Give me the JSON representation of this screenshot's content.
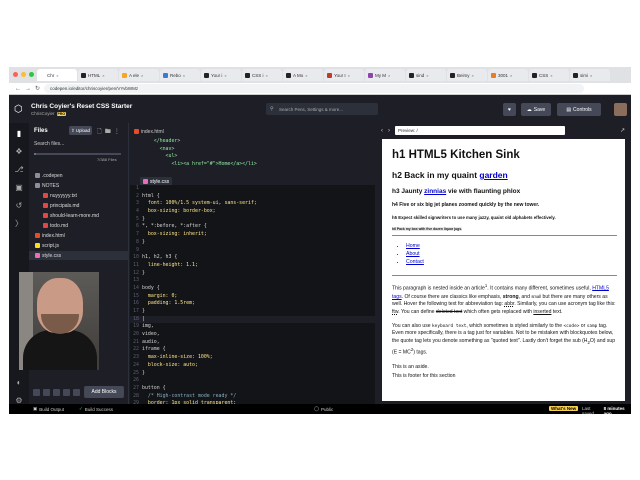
{
  "browser": {
    "tabs": [
      {
        "label": "Chr",
        "active": true,
        "fav": "#ffffff"
      },
      {
        "label": "HTML",
        "active": false,
        "fav": "#222"
      },
      {
        "label": "A ele",
        "active": false,
        "fav": "#f5a623"
      },
      {
        "label": "Rebo",
        "active": false,
        "fav": "#3a7bd5"
      },
      {
        "label": "Your i",
        "active": false,
        "fav": "#222"
      },
      {
        "label": "CSS i",
        "active": false,
        "fav": "#222"
      },
      {
        "label": "A Mo",
        "active": false,
        "fav": "#222"
      },
      {
        "label": "Your I",
        "active": false,
        "fav": "#c0392b"
      },
      {
        "label": "My M",
        "active": false,
        "fav": "#8e44ad"
      },
      {
        "label": "sind",
        "active": false,
        "fav": "#222"
      },
      {
        "label": "Beimy",
        "active": false,
        "fav": "#222"
      },
      {
        "label": "3001",
        "active": false,
        "fav": "#e67e22"
      },
      {
        "label": "CSS",
        "active": false,
        "fav": "#222"
      },
      {
        "label": "simi",
        "active": false,
        "fav": "#222"
      }
    ],
    "url": "codepen.io/editor/chriscoyier/pen/VYvbWMz"
  },
  "header": {
    "pen_title": "Chris Coyier's Reset CSS Starter",
    "author": "ChrisCoyier",
    "pro_badge": "PRO",
    "search_placeholder": "Search Pens, Settings & more...",
    "save_label": "Save",
    "controls_label": "Controls"
  },
  "files": {
    "title": "Files",
    "upload_label": "Upload",
    "search_label": "Search files...",
    "storage_text": "7/388 Files",
    "storage_fraction": 0.02,
    "items": [
      {
        "label": ".codepen",
        "color": "#8a8f9c",
        "indent": 0
      },
      {
        "label": "NOTES",
        "color": "#8a8f9c",
        "indent": 0
      },
      {
        "label": "nuyyyyyy.txt",
        "color": "#e04848",
        "indent": 1
      },
      {
        "label": "principals.md",
        "color": "#e04848",
        "indent": 1
      },
      {
        "label": "should-learn-more.md",
        "color": "#e04848",
        "indent": 1
      },
      {
        "label": "todo.md",
        "color": "#e04848",
        "indent": 1
      },
      {
        "label": "index.html",
        "color": "#e44d26",
        "indent": 0
      },
      {
        "label": "script.js",
        "color": "#f7df1e",
        "indent": 0
      },
      {
        "label": "style.css",
        "color": "#ec6cb9",
        "indent": 0,
        "selected": true
      }
    ],
    "add_blocks_label": "Add Blocks"
  },
  "editor": {
    "html_tab_label": "index.html",
    "css_tab_label": "style.css",
    "html_lines": [
      {
        "n": "",
        "code": "    </header>",
        "cls": "c-tag"
      },
      {
        "n": "",
        "code": "      <nav>",
        "cls": "c-tag"
      },
      {
        "n": "",
        "code": "        <ul>",
        "cls": "c-tag"
      },
      {
        "n": "",
        "code": "          <li><a href=\"#\">Home</a></li>",
        "cls": "c-tag"
      }
    ],
    "css_lines": [
      {
        "n": "1",
        "code": "",
        "cls": "cv"
      },
      {
        "n": "2",
        "code": "html {",
        "cls": "c-sel"
      },
      {
        "n": "3",
        "code": "  font: 100%/1.5 system-ui, sans-serif;",
        "cls": "c-val"
      },
      {
        "n": "4",
        "code": "  box-sizing: border-box;",
        "cls": "c-val"
      },
      {
        "n": "5",
        "code": "}",
        "cls": "c-sel"
      },
      {
        "n": "6",
        "code": "*, *:before, *:after {",
        "cls": "c-sel"
      },
      {
        "n": "7",
        "code": "  box-sizing: inherit;",
        "cls": "c-val"
      },
      {
        "n": "8",
        "code": "}",
        "cls": "c-sel"
      },
      {
        "n": "9",
        "code": "",
        "cls": "cv"
      },
      {
        "n": "10",
        "code": "h1, h2, h3 {",
        "cls": "c-sel"
      },
      {
        "n": "11",
        "code": "  line-height: 1.1;",
        "cls": "c-val"
      },
      {
        "n": "12",
        "code": "}",
        "cls": "c-sel"
      },
      {
        "n": "13",
        "code": "",
        "cls": "cv"
      },
      {
        "n": "14",
        "code": "body {",
        "cls": "c-sel"
      },
      {
        "n": "15",
        "code": "  margin: 0;",
        "cls": "c-val"
      },
      {
        "n": "16",
        "code": "  padding: 1.5rem;",
        "cls": "c-val"
      },
      {
        "n": "17",
        "code": "}",
        "cls": "c-sel"
      },
      {
        "n": "18",
        "code": "|",
        "cls": "cv",
        "cursor": true
      },
      {
        "n": "19",
        "code": "img,",
        "cls": "c-sel"
      },
      {
        "n": "20",
        "code": "video,",
        "cls": "c-sel"
      },
      {
        "n": "21",
        "code": "audio,",
        "cls": "c-sel"
      },
      {
        "n": "22",
        "code": "iframe {",
        "cls": "c-sel"
      },
      {
        "n": "23",
        "code": "  max-inline-size: 100%;",
        "cls": "c-val"
      },
      {
        "n": "24",
        "code": "  block-size: auto;",
        "cls": "c-val"
      },
      {
        "n": "25",
        "code": "}",
        "cls": "c-sel"
      },
      {
        "n": "26",
        "code": "",
        "cls": "cv"
      },
      {
        "n": "27",
        "code": "button {",
        "cls": "c-sel"
      },
      {
        "n": "28",
        "code": "  /* High-contrast mode ready */",
        "cls": "c-com"
      },
      {
        "n": "29",
        "code": "  border: 1px solid transparent;",
        "cls": "c-val"
      },
      {
        "n": "30",
        "code": "}",
        "cls": "c-sel"
      },
      {
        "n": "31",
        "code": "",
        "cls": "cv"
      },
      {
        "n": "32",
        "code": "input,",
        "cls": "c-sel"
      }
    ]
  },
  "preview": {
    "url_label": "Preview: /",
    "h1": "h1 HTML5 Kitchen Sink",
    "h2_prefix": "h2 Back in my quaint ",
    "h2_link": "garden",
    "h3_prefix": "h3 Jaunty ",
    "h3_link": "zinnias",
    "h3_suffix": " vie with flaunting phlox",
    "h4": "h4 Five or six big jet planes zoomed quickly by the new tower.",
    "h5": "h5 Expect skilled signwriters to use many jazzy, quaint old alphabets effectively.",
    "h6": "h6 Pack my box with five dozen liquor jugs.",
    "nav": [
      "Home",
      "About",
      "Contact"
    ],
    "p1_a": "This paragraph is nested inside an article",
    "p1_sup": "1",
    "p1_b": ". It contains many different, sometimes useful, ",
    "p1_link": "HTML5 tags",
    "p1_c": ". Of course there are classics like emphasis, ",
    "p1_strong": "strong",
    "p1_d": ", and ",
    "p1_small": "small",
    "p1_e": " but there are many others as well. Hover the following text for abbreviation tag: ",
    "p1_abbr": "abbr",
    "p1_f": ". Similarly, you can use acronym tag like this: ",
    "p1_acr": "ftw",
    "p1_g": ". You can define ",
    "p1_del": "deleted text",
    "p1_h": " which often gets replaced with ",
    "p1_ins": "inserted",
    "p1_i": " text.",
    "p2_a": "You can also use ",
    "p2_kbd": "keyboard text",
    "p2_b": ", which sometimes is styled similarly to the ",
    "p2_code": "<code>",
    "p2_c": " or ",
    "p2_samp": "samp",
    "p2_d": " tag. Even more specifically, there is a tag just for variables. Not to be mistaken with blockquotes below, the quote tag lets you denote something as \"quoted text\". Lastly don't forget the sub (H",
    "p2_sub": "2",
    "p2_e": "O) and sup (E = MC",
    "p2_sup": "2",
    "p2_f": ") tags.",
    "aside": "This is an aside.",
    "footer": "This is footer for this section"
  },
  "footer": {
    "build_output": "Build Output",
    "build_success": "Build Success",
    "visibility": "Public",
    "whats_new": "What's New",
    "last_saved": "Last saved",
    "last_saved_time": "8 minutes ago"
  }
}
